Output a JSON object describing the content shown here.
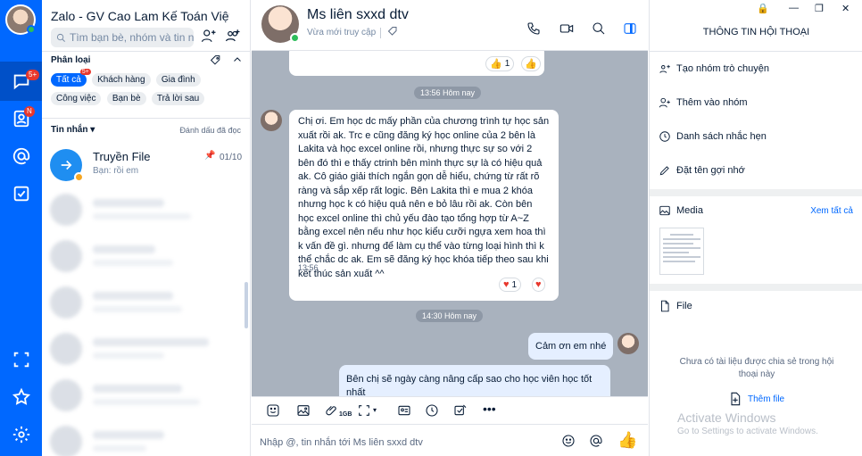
{
  "app": {
    "title": "Zalo - GV Cao Lam Kế Toán Việt ..."
  },
  "rail": {
    "messages_badge": "5+",
    "contacts_badge": "N"
  },
  "sidebar": {
    "search_placeholder": "Tìm bạn bè, nhóm và tin nhắn",
    "category_title": "Phân loại",
    "chips": [
      {
        "label": "Tất cả",
        "active": true,
        "badge": "5+"
      },
      {
        "label": "Khách hàng"
      },
      {
        "label": "Gia đình"
      },
      {
        "label": "Công việc"
      },
      {
        "label": "Bạn bè"
      },
      {
        "label": "Trả lời sau"
      }
    ],
    "messages_title": "Tin nhắn",
    "mark_read": "Đánh dấu đã đọc",
    "conversation": {
      "name": "Truyền File",
      "preview": "Bạn: rồi em",
      "count": "01/10"
    }
  },
  "chat": {
    "name": "Ms liên sxxd dtv",
    "status": "Vừa mới truy cập",
    "top_reaction_count": "1",
    "divider1": "13:56 Hôm nay",
    "message1": "Chị ơi. Em học dc mấy phần của chương trình tự học sản xuất rồi ak. Trc e cũng đăng ký học online của 2 bên là Lakita và học excel online rồi, nhưng thực sự so với 2 bên đó thì e thấy ctrinh bên mình thực sự là có hiệu quả ak. Cô giáo giải thích ngắn gọn dễ hiểu, chứng từ rất rõ ràng và sắp xếp rất logic. Bên Lakita thì e mua 2 khóa nhưng học k có hiệu quả nên e bỏ lâu rồi ak. Còn bên học excel online thì chủ yếu đào tạo tổng hợp từ A~Z bằng excel nên nếu như học kiểu cưỡi ngựa xem hoa thì k vấn đề gì. nhưng để làm cụ thể vào từng loại hình thì k thể chắc dc ak. Em sẽ đăng ký học khóa tiếp theo sau khi kết thúc sản xuất ^^",
    "message1_time": "13:56",
    "message1_reaction_count": "1",
    "divider2": "14:30 Hôm nay",
    "reply1": "Cảm ơn em nhé",
    "reply2": "Bên chị sẽ ngày càng nâng cấp sao cho học viên học tốt nhất",
    "file_size_label": "1GB",
    "input_placeholder": "Nhập @, tin nhắn tới Ms liên sxxd dtv"
  },
  "info": {
    "title": "THÔNG TIN HỘI THOẠI",
    "actions": [
      "Tạo nhóm trò chuyện",
      "Thêm vào nhóm",
      "Danh sách nhắc hẹn",
      "Đặt tên gợi nhớ"
    ],
    "media_title": "Media",
    "see_all": "Xem tất cả",
    "file_title": "File",
    "no_file": "Chưa có tài liệu được chia sẻ trong hội thoại này",
    "add_file": "Thêm file"
  },
  "watermark": {
    "line1": "Activate Windows",
    "line2": "Go to Settings to activate Windows."
  },
  "colors": {
    "brand": "#0068ff",
    "chat_bg": "#a9b2be",
    "my_bubble": "#e5efff"
  }
}
